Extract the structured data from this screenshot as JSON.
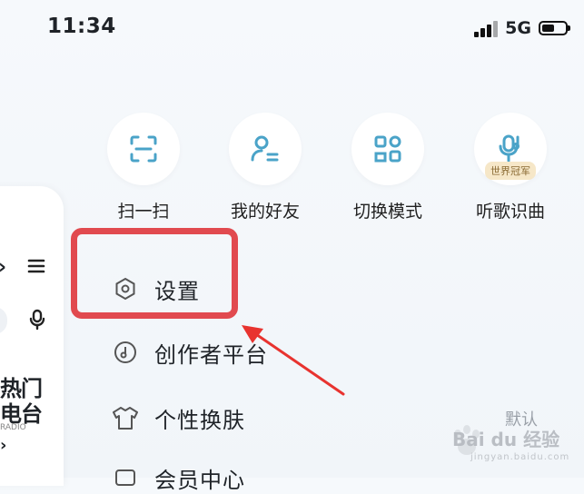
{
  "status_bar": {
    "time": "11:34",
    "network": "5G"
  },
  "quick_actions": [
    {
      "label": "扫一扫",
      "icon": "scan-icon"
    },
    {
      "label": "我的好友",
      "icon": "friends-icon"
    },
    {
      "label": "切换模式",
      "icon": "switch-mode-icon"
    },
    {
      "label": "听歌识曲",
      "icon": "song-recognition-icon",
      "badge": "世界冠军"
    }
  ],
  "menu": [
    {
      "label": "设置",
      "icon": "settings-icon"
    },
    {
      "label": "创作者平台",
      "icon": "creator-icon"
    },
    {
      "label": "个性换肤",
      "icon": "skin-icon",
      "value": "默认"
    },
    {
      "label": "会员中心",
      "icon": "vip-icon"
    }
  ],
  "left_panel": {
    "card_line1": "热门",
    "card_line2": "电台",
    "card_line3": "RADIO"
  },
  "watermark": {
    "text": "Bai du 经验",
    "sub": "jingyan.baidu.com"
  },
  "colors": {
    "accent": "#4aa3c8",
    "highlight": "#e14a4f"
  }
}
